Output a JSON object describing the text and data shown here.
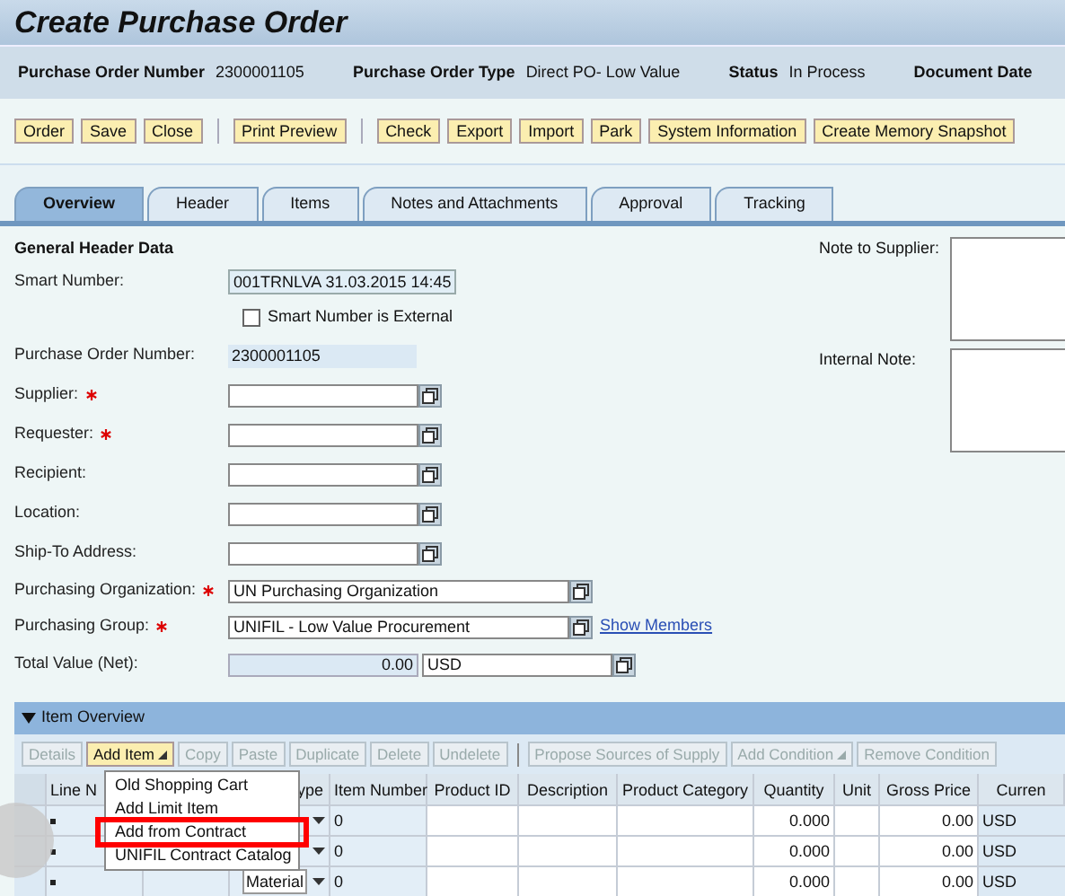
{
  "title": "Create Purchase Order",
  "info": [
    {
      "label": "Purchase Order Number",
      "value": "2300001105"
    },
    {
      "label": "Purchase Order Type",
      "value": "Direct PO- Low Value"
    },
    {
      "label": "Status",
      "value": "In Process"
    },
    {
      "label": "Document Date"
    }
  ],
  "toolbar": [
    [
      "Order",
      "Save",
      "Close"
    ],
    [
      "Print Preview"
    ],
    [
      "Check",
      "Export",
      "Import",
      "Park",
      "System Information",
      "Create Memory Snapshot"
    ]
  ],
  "tabs": [
    {
      "label": "Overview",
      "selected": true
    },
    {
      "label": "Header",
      "selected": false
    },
    {
      "label": "Items",
      "selected": false
    },
    {
      "label": "Notes and Attachments",
      "selected": false
    },
    {
      "label": "Approval",
      "selected": false
    },
    {
      "label": "Tracking",
      "selected": false
    }
  ],
  "section_title": "General Header Data",
  "fields": [
    {
      "kind": "readonly",
      "label": "Smart Number:",
      "value": "001TRNLVA 31.03.2015 14:45",
      "required": false
    },
    {
      "kind": "checkbox",
      "label": "Smart Number is External",
      "checked": false
    },
    {
      "kind": "shaded",
      "label": "Purchase Order Number:",
      "value": "2300001105",
      "required": false
    },
    {
      "kind": "lookup",
      "label": "Supplier:",
      "required": true
    },
    {
      "kind": "lookup",
      "label": "Requester:",
      "required": true
    },
    {
      "kind": "lookup",
      "label": "Recipient:",
      "required": false
    },
    {
      "kind": "lookup",
      "label": "Location:",
      "required": false
    },
    {
      "kind": "lookup",
      "label": "Ship-To Address:",
      "required": false
    },
    {
      "kind": "widelookup",
      "label": "Purchasing Organization:",
      "value": "UN Purchasing Organization",
      "required": true
    },
    {
      "kind": "widelookup",
      "label": "Purchasing Group:",
      "value": "UNIFIL - Low Value Procurement",
      "required": true,
      "link": "Show Members"
    },
    {
      "kind": "amount",
      "label": "Total Value (Net):",
      "value": "0.00",
      "currency": "USD",
      "required": false
    }
  ],
  "notes": [
    "Note to Supplier:",
    "Internal Note:"
  ],
  "item_overview": {
    "title": "Item Overview",
    "buttons": [
      {
        "label": "Details",
        "disabled": true
      },
      {
        "label": "Add Item",
        "disabled": false,
        "menu": true
      },
      {
        "label": "Copy",
        "disabled": true
      },
      {
        "label": "Paste",
        "disabled": true
      },
      {
        "label": "Duplicate",
        "disabled": true
      },
      {
        "label": "Delete",
        "disabled": true
      },
      {
        "label": "Undelete",
        "disabled": true
      },
      {
        "label": "Propose Sources of Supply",
        "disabled": true,
        "separator": true
      },
      {
        "label": "Add Condition",
        "disabled": true,
        "menu": true
      },
      {
        "label": "Remove Condition",
        "disabled": true
      }
    ],
    "columns": [
      "Line N",
      "",
      "ype",
      "Item Number",
      "Product ID",
      "Description",
      "Product Category",
      "Quantity",
      "Unit",
      "Gross Price",
      "Curren"
    ],
    "rows": [
      {
        "item_number": "0",
        "quantity": "0.000",
        "gross_price": "0.00",
        "currency": "USD"
      },
      {
        "item_number": "0",
        "quantity": "0.000",
        "gross_price": "0.00",
        "currency": "USD"
      },
      {
        "type": "Material",
        "item_number": "0",
        "quantity": "0.000",
        "gross_price": "0.00",
        "currency": "USD"
      }
    ],
    "menu": [
      {
        "label": "Old Shopping Cart",
        "highlighted": false
      },
      {
        "label": "Add Limit Item",
        "highlighted": false
      },
      {
        "label": "Add from Contract",
        "highlighted": true
      },
      {
        "label": "UNIFIL Contract Catalog",
        "highlighted": false
      }
    ]
  }
}
